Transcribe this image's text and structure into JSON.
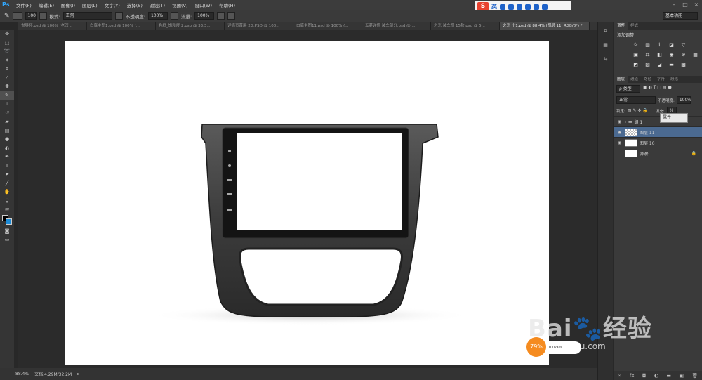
{
  "app": {
    "logo": "Ps"
  },
  "menubar": {
    "items": [
      "文件(F)",
      "编辑(E)",
      "图像(I)",
      "图层(L)",
      "文字(Y)",
      "选择(S)",
      "滤镜(T)",
      "视图(V)",
      "窗口(W)",
      "帮助(H)"
    ]
  },
  "ime": {
    "brand": "S",
    "mode": "英"
  },
  "options": {
    "brush_size": "100",
    "mode_label": "模式:",
    "mode_value": "正常",
    "opacity_label": "不透明度:",
    "opacity_value": "100%",
    "flow_label": "流量:",
    "flow_value": "100%",
    "workspace": "基本功能"
  },
  "tabs": [
    {
      "label": "世界杯.psd @ 100% (老汉...",
      "active": false
    },
    {
      "label": "白底主图1.psd @ 100% (...",
      "active": false
    },
    {
      "label": "色框_饱和度 2.psb @ 33.3...",
      "active": false
    },
    {
      "label": "详情页首屏 2G.PSD @ 100...",
      "active": false
    },
    {
      "label": "白底主图11.psd @ 100% (...",
      "active": false
    },
    {
      "label": "五菱详情 装车部分.psd @ ...",
      "active": false
    },
    {
      "label": "之光 装车图 15款.psd @ 5...",
      "active": false
    },
    {
      "label": "之光 小1.psd @ 88.4% (图层 11, RGB/8*) *",
      "active": true
    }
  ],
  "statusbar": {
    "zoom": "88.4%",
    "doc": "文档:4.29M/32.2M"
  },
  "panels": {
    "adjust_tabs": [
      "调整",
      "样式"
    ],
    "adjust_title": "添加调整",
    "layer_tabs": [
      "图层",
      "通道",
      "路径",
      "字符",
      "段落"
    ],
    "filter_label": "ρ 类型",
    "blend_mode": "正常",
    "opacity_label": "不透明度:",
    "opacity_value": "100%",
    "lock_label": "锁定:",
    "fill_label": "填充:",
    "fill_value": "%",
    "layers": [
      {
        "name": "组 1",
        "type": "group",
        "selected": false
      },
      {
        "name": "图层 11",
        "type": "checker",
        "selected": true
      },
      {
        "name": "图层 10",
        "type": "white",
        "selected": false
      },
      {
        "name": "背景",
        "type": "background",
        "selected": false
      }
    ],
    "tooltip": "属性"
  },
  "watermark": {
    "brand": "Bai",
    "brand2": "经验",
    "url": "jingyan.baidu.com"
  },
  "speed": {
    "percent": "79%",
    "rate": "0.07K/s"
  }
}
